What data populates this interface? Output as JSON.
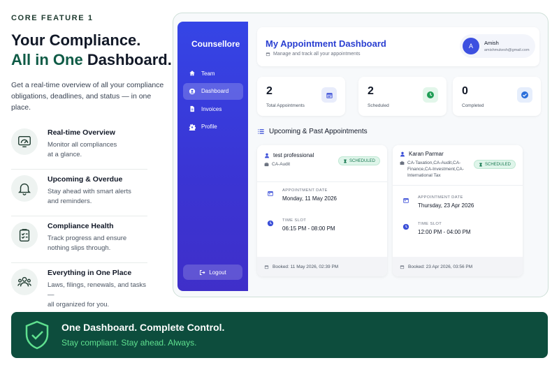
{
  "eyebrow": "CORE FEATURE 1",
  "headline": {
    "line1": "Your Compliance.",
    "line2_accent": "All in One",
    "line2_rest": "Dashboard."
  },
  "intro": "Get a real-time overview of all your compliance obligations, deadlines, and status — in one place.",
  "features": [
    {
      "icon": "gauge-icon",
      "title": "Real-time Overview",
      "desc_line1": "Monitor all compliances",
      "desc_line2": "at a glance."
    },
    {
      "icon": "bell-icon",
      "title": "Upcoming & Overdue",
      "desc_line1": "Stay ahead with smart alerts",
      "desc_line2": "and reminders."
    },
    {
      "icon": "clipboard-check-icon",
      "title": "Compliance Health",
      "desc_line1": "Track progress and ensure",
      "desc_line2": "nothing slips through."
    },
    {
      "icon": "users-icon",
      "title": "Everything in One Place",
      "desc_line1": "Laws, filings, renewals, and tasks —",
      "desc_line2": "all organized for you."
    }
  ],
  "app": {
    "brand": "Counsellore",
    "nav": [
      {
        "label": "Team",
        "icon": "home-icon",
        "active": false
      },
      {
        "label": "Dashboard",
        "icon": "user-circle-icon",
        "active": true
      },
      {
        "label": "Invoices",
        "icon": "file-icon",
        "active": false
      },
      {
        "label": "Profile",
        "icon": "gear-icon",
        "active": false
      }
    ],
    "logout_label": "Logout",
    "title": "My Appointment Dashboard",
    "subtitle": "Manage and track all your appointments",
    "user": {
      "initial": "A",
      "name": "Amish",
      "email": "amishmukesh@gmail.com"
    },
    "stats": [
      {
        "value": "2",
        "label": "Total Appointments",
        "icon": "calendar-icon",
        "color": "#3b4fd8",
        "bg": "#e8ecfb"
      },
      {
        "value": "2",
        "label": "Scheduled",
        "icon": "clock-icon",
        "color": "#1f9d55",
        "bg": "#e2f6ea"
      },
      {
        "value": "0",
        "label": "Completed",
        "icon": "check-circle-icon",
        "color": "#2b6fdb",
        "bg": "#e6eefc"
      }
    ],
    "section_title": "Upcoming & Past Appointments",
    "appointments": [
      {
        "name": "test professional",
        "category": "CA-Audit",
        "status": "SCHEDULED",
        "date_label": "APPOINTMENT DATE",
        "date": "Monday, 11 May 2026",
        "slot_label": "TIME SLOT",
        "slot": "06:15 PM - 08:00 PM",
        "booked": "Booked: 11 May 2026, 02:39 PM"
      },
      {
        "name": "Karan Parmar",
        "category_line1": "CA-Taxation,CA-Audit,CA-",
        "category_line2": "Finance,CA-Investment,CA-",
        "category_line3": "International Tax",
        "status": "SCHEDULED",
        "date_label": "APPOINTMENT DATE",
        "date": "Thursday, 23 Apr 2026",
        "slot_label": "TIME SLOT",
        "slot": "12:00 PM - 04:00 PM",
        "booked": "Booked: 23 Apr 2026, 03:56 PM"
      }
    ]
  },
  "banner": {
    "icon": "shield-check-icon",
    "title": "One Dashboard. Complete Control.",
    "subtitle": "Stay compliant. Stay ahead. Always."
  },
  "colors": {
    "brand_green": "#0d4d3d",
    "accent_green": "#5fe08f",
    "sidebar_blue": "#3545e6"
  }
}
